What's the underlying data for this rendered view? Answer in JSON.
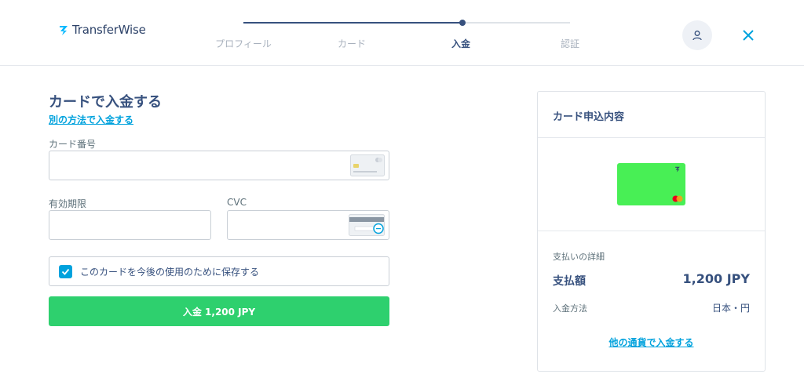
{
  "brand": {
    "name": "TransferWise"
  },
  "progress": {
    "steps": [
      "プロフィール",
      "カード",
      "入金",
      "認証"
    ],
    "active_index": 2,
    "fraction_complete": 0.67
  },
  "form": {
    "title": "カードで入金する",
    "alt_link": "別の方法で入金する",
    "card_number_label": "カード番号",
    "card_number_value": "",
    "expiry_label": "有効期限",
    "expiry_value": "",
    "cvc_label": "CVC",
    "cvc_value": "",
    "save_card_label": "このカードを今後の使用のために保存する",
    "save_card_checked": true,
    "pay_button": "入金 1,200 JPY"
  },
  "summary": {
    "title": "カード申込内容",
    "details_heading": "支払いの詳細",
    "amount_label": "支払額",
    "amount_value": "1,200 JPY",
    "method_label": "入金方法",
    "method_value": "日本・円",
    "other_currency_link": "他の通貨で入金する"
  },
  "colors": {
    "primary_text": "#37517e",
    "accent_blue": "#00a2dd",
    "pay_green": "#2ed06e",
    "card_green": "#48ef55"
  },
  "icons": [
    "wise-logo-icon",
    "user-icon",
    "close-icon",
    "card-chip-icon",
    "cvc-icon",
    "check-icon",
    "mastercard-icon"
  ]
}
